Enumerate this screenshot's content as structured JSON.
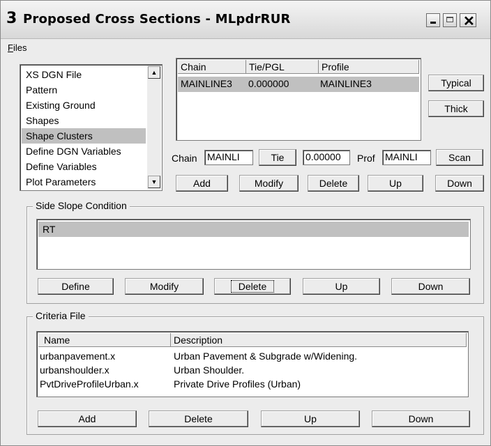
{
  "window": {
    "title": "Proposed Cross Sections - MLpdrRUR",
    "app_icon": "3"
  },
  "menu": {
    "files": "Files"
  },
  "categories": {
    "items": [
      {
        "label": "XS DGN File",
        "selected": false
      },
      {
        "label": "Pattern",
        "selected": false
      },
      {
        "label": "Existing Ground",
        "selected": false
      },
      {
        "label": "Shapes",
        "selected": false
      },
      {
        "label": "Shape Clusters",
        "selected": true
      },
      {
        "label": "Define DGN Variables",
        "selected": false
      },
      {
        "label": "Define Variables",
        "selected": false
      },
      {
        "label": "Plot Parameters",
        "selected": false
      }
    ]
  },
  "chain_table": {
    "headers": [
      "Chain",
      "Tie/PGL",
      "Profile"
    ],
    "rows": [
      [
        "MAINLINE3",
        "0.000000",
        "MAINLINE3"
      ]
    ]
  },
  "buttons": {
    "typical": "Typical",
    "thick": "Thick",
    "scan": "Scan",
    "add": "Add",
    "modify": "Modify",
    "delete": "Delete",
    "up": "Up",
    "down": "Down"
  },
  "chain_row": {
    "chain_label": "Chain",
    "chain_value": "MAINLI",
    "tie_button": "Tie",
    "tie_value": "0.00000",
    "prof_label": "Prof",
    "prof_value": "MAINLI"
  },
  "side_slope": {
    "title": "Side Slope Condition",
    "items": [
      {
        "label": "RT",
        "selected": true
      }
    ],
    "buttons": {
      "define": "Define",
      "modify": "Modify",
      "delete": "Delete",
      "up": "Up",
      "down": "Down"
    }
  },
  "criteria": {
    "title": "Criteria File",
    "headers": [
      "Name",
      "Description"
    ],
    "rows": [
      [
        "urbanpavement.x",
        "Urban Pavement & Subgrade w/Widening."
      ],
      [
        "urbanshoulder.x",
        "Urban Shoulder."
      ],
      [
        "PvtDriveProfileUrban.x",
        "Private Drive Profiles (Urban)"
      ]
    ],
    "buttons": {
      "add": "Add",
      "delete": "Delete",
      "up": "Up",
      "down": "Down"
    }
  },
  "icons": {
    "minimize": "minimize-icon",
    "maximize": "maximize-icon",
    "close": "close-icon",
    "scroll_up": "arrow-up-icon",
    "scroll_down": "arrow-down-icon"
  }
}
